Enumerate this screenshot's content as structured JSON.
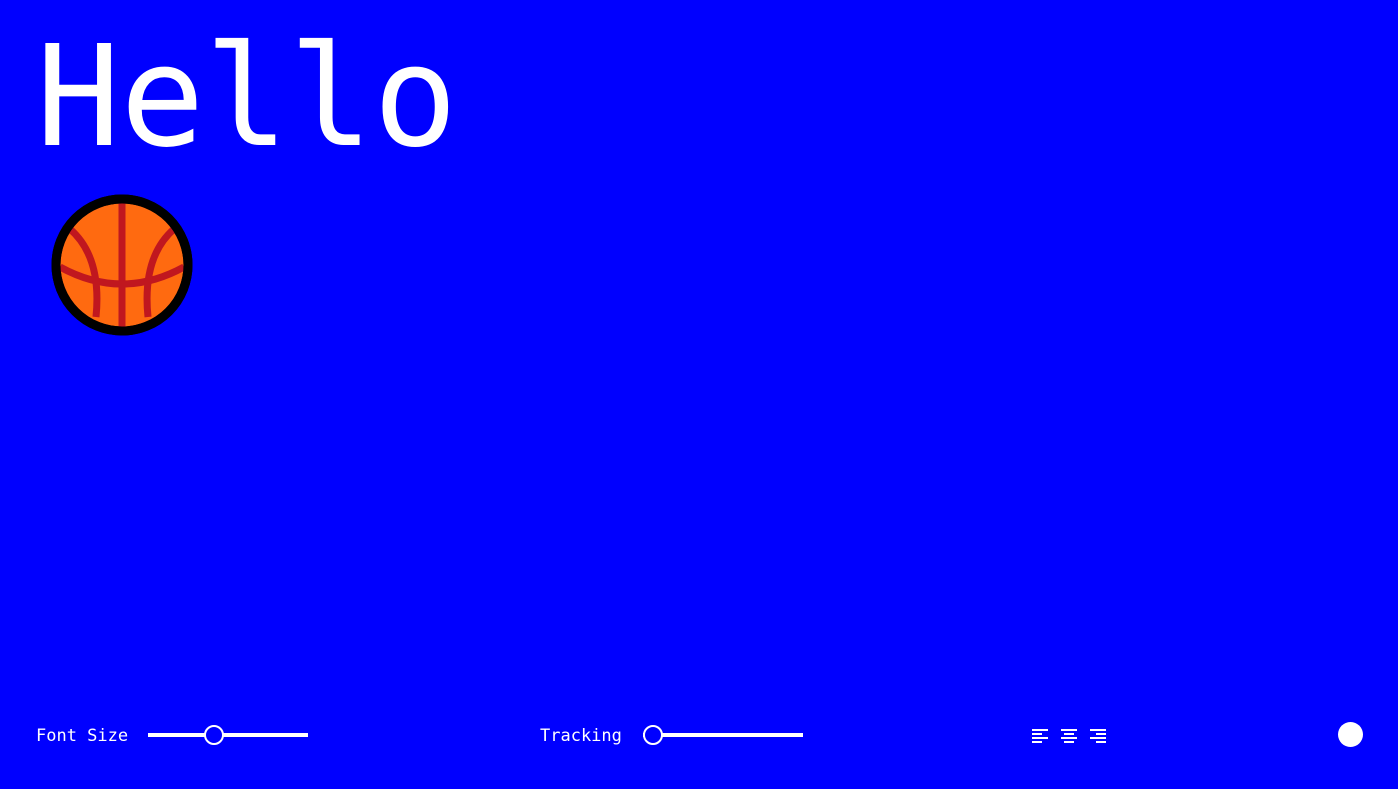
{
  "preview": {
    "text": "Hello",
    "emoji_icon": "basketball-icon"
  },
  "controls": {
    "font_size": {
      "label": "Font Size",
      "value_fraction": 0.41
    },
    "tracking": {
      "label": "Tracking",
      "value_fraction": 0.06
    },
    "alignment": {
      "options": [
        "align-left-icon",
        "align-center-icon",
        "align-right-icon"
      ],
      "selected": "left"
    },
    "color_picker": {
      "color": "#ffffff"
    }
  },
  "colors": {
    "background": "#0000ff",
    "foreground": "#ffffff",
    "ball_orange": "#ff6a10",
    "ball_lines": "#c0171f"
  }
}
